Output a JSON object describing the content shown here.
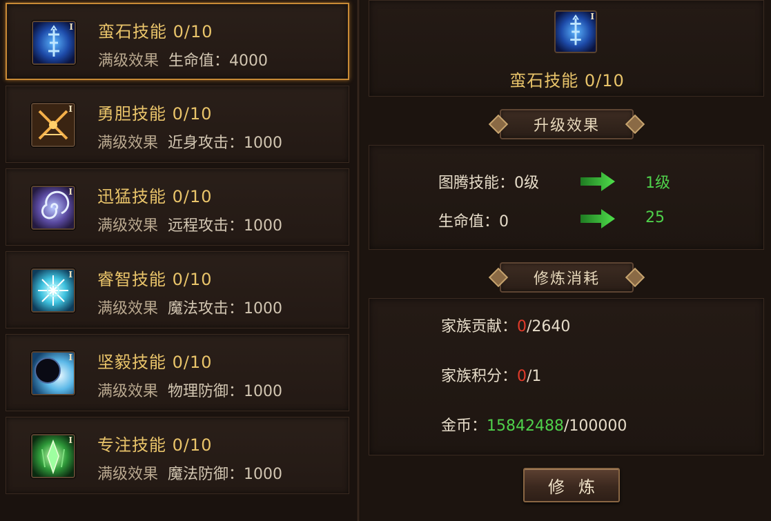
{
  "skills": [
    {
      "name": "蛮石技能",
      "progress": "0/10",
      "label": "满级效果",
      "effect": "生命值：4000",
      "icon": "rune-stone-icon",
      "tier": "I"
    },
    {
      "name": "勇胆技能",
      "progress": "0/10",
      "label": "满级效果",
      "effect": "近身攻击：1000",
      "icon": "crossed-swords-icon",
      "tier": "I"
    },
    {
      "name": "迅猛技能",
      "progress": "0/10",
      "label": "满级效果",
      "effect": "远程攻击：1000",
      "icon": "whirlwind-icon",
      "tier": "I"
    },
    {
      "name": "睿智技能",
      "progress": "0/10",
      "label": "满级效果",
      "effect": "魔法攻击：1000",
      "icon": "magic-star-icon",
      "tier": "I"
    },
    {
      "name": "坚毅技能",
      "progress": "0/10",
      "label": "满级效果",
      "effect": "物理防御：1000",
      "icon": "dark-orb-shield-icon",
      "tier": "I"
    },
    {
      "name": "专注技能",
      "progress": "0/10",
      "label": "满级效果",
      "effect": "魔法防御：1000",
      "icon": "green-crystal-icon",
      "tier": "I"
    }
  ],
  "detail": {
    "tier": "I",
    "title": "蛮石技能 0/10",
    "upgrade_banner": "升级效果",
    "upgrade_rows": [
      {
        "label": "图腾技能：0级",
        "next": "1级"
      },
      {
        "label": "生命值：0",
        "next": "25"
      }
    ],
    "cost_banner": "修炼消耗",
    "costs": [
      {
        "label": "家族贡献：",
        "have": "0",
        "need": "/2640",
        "have_color": "#e13b2a"
      },
      {
        "label": "家族积分：",
        "have": "0",
        "need": "/1",
        "have_color": "#e13b2a"
      },
      {
        "label": "金币：",
        "have": "15842488",
        "need": "/100000",
        "have_color": "#4fd14b"
      }
    ],
    "practice_button": "修炼"
  }
}
